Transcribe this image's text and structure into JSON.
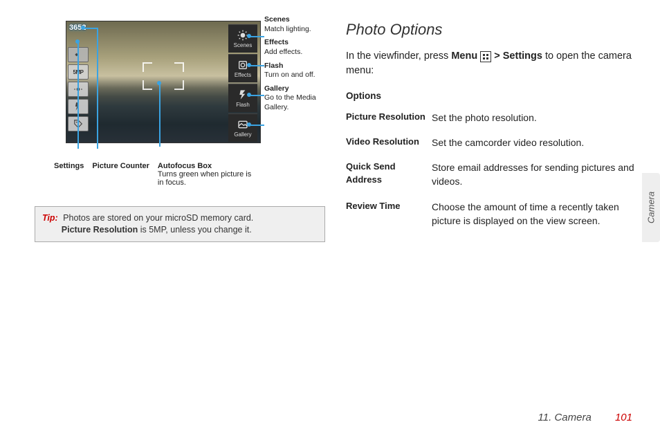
{
  "section_tab": "Camera",
  "footer": {
    "chapter": "11. Camera",
    "page": "101"
  },
  "shot": {
    "counter": "3652",
    "left_icons": [
      "gps",
      "5MP",
      "brightness",
      "flash-auto",
      "tag"
    ],
    "right_tiles": [
      {
        "label": "Scenes"
      },
      {
        "label": "Effects"
      },
      {
        "label": "Flash"
      },
      {
        "label": "Gallery"
      }
    ]
  },
  "under": {
    "settings": {
      "title": "Settings"
    },
    "counter": {
      "title": "Picture Counter"
    },
    "autofocus": {
      "title": "Autofocus Box",
      "desc": "Turns green when picture is in focus."
    }
  },
  "right_annos": [
    {
      "title": "Scenes",
      "desc": "Match lighting."
    },
    {
      "title": "Effects",
      "desc": "Add effects."
    },
    {
      "title": "Flash",
      "desc": "Turn on and off."
    },
    {
      "title": "Gallery",
      "desc": "Go to the Media Gallery."
    }
  ],
  "tip": {
    "label": "Tip:",
    "line1": "Photos are stored on your microSD memory card.",
    "line2_pre": "",
    "line2_bold": "Picture Resolution",
    "line2_post": " is 5MP, unless you change it."
  },
  "heading": "Photo Options",
  "intro": {
    "pre": "In the viewfinder, press ",
    "menu": "Menu",
    "gt": ">",
    "settings": "Settings",
    "post": " to open the camera menu:"
  },
  "table": {
    "header": "Options",
    "rows": [
      {
        "k": "Picture Resolution",
        "v": "Set the photo resolution."
      },
      {
        "k": "Video Resolution",
        "v": "Set the camcorder video resolution."
      },
      {
        "k": "Quick Send Address",
        "v": "Store email addresses for sending pictures and videos."
      },
      {
        "k": "Review Time",
        "v": "Choose the amount of time a recently taken picture is displayed on the view screen."
      }
    ]
  }
}
